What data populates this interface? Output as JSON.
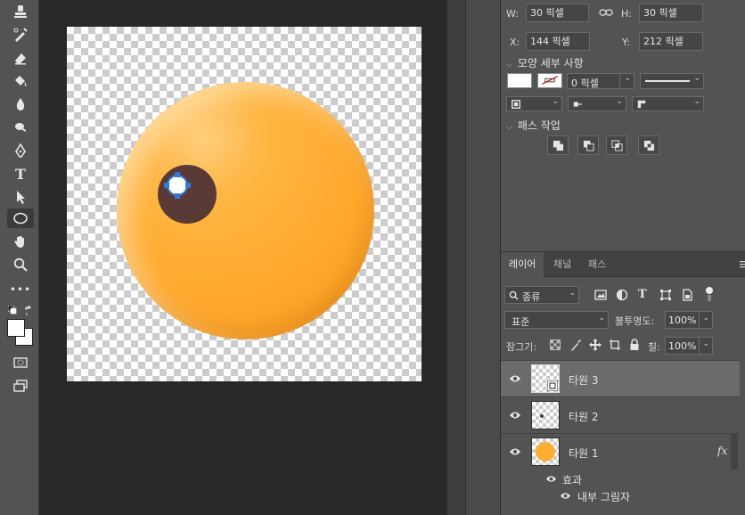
{
  "toolbar": {
    "tools": [
      "stamp-tool",
      "brush-history-tool",
      "eraser-tool",
      "paint-bucket-tool",
      "blur-tool",
      "dodge-tool",
      "pen-tool",
      "type-tool",
      "path-selection-tool",
      "ellipse-tool",
      "hand-tool",
      "zoom-tool",
      "more-tools",
      "color-swap",
      "color-swatches",
      "quick-mask",
      "screen-mode"
    ],
    "active_tool": "ellipse-tool",
    "foreground_color": "#ffffff",
    "background_color": "#ffffff",
    "type_glyph": "T",
    "more_glyph": "•••"
  },
  "canvas": {
    "orange_color": "#ffad33",
    "pupil_color": "#5a3a36",
    "highlight_color": "#ffffff",
    "selection_color": "#2f7ad6"
  },
  "properties": {
    "w_label": "W:",
    "w_value": "30 픽셀",
    "h_label": "H:",
    "h_value": "30 픽셀",
    "x_label": "X:",
    "x_value": "144 픽셀",
    "y_label": "Y:",
    "y_value": "212 픽셀",
    "shape_section": "모양 세부 사항",
    "stroke_width": "0 픽셀",
    "path_ops_section": "패스 작업"
  },
  "layers_panel": {
    "tabs": [
      "레이어",
      "채널",
      "패스"
    ],
    "filter_label": "종류",
    "blend_mode": "표준",
    "opacity_label": "불투명도:",
    "opacity_value": "100%",
    "lock_label": "잠그기:",
    "fill_label": "칠:",
    "fill_value": "100%",
    "filter_t_glyph": "T",
    "layers": [
      {
        "name": "타원 3",
        "selected": true
      },
      {
        "name": "타원 2",
        "selected": false
      },
      {
        "name": "타원 1",
        "selected": false,
        "fx": "fx"
      }
    ],
    "effects_label": "효과",
    "inner_shadow_label": "내부 그림자"
  }
}
